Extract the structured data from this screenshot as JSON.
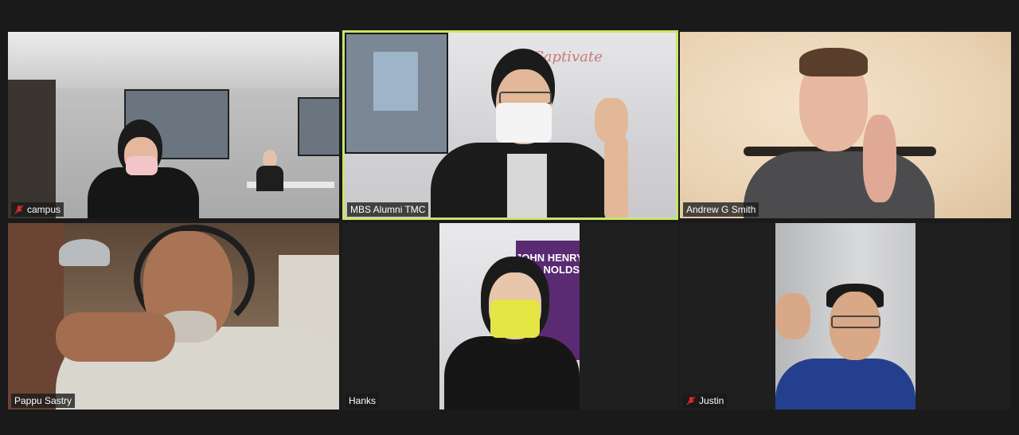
{
  "colors": {
    "background": "#1a1a1a",
    "active_speaker_border": "#c8e66b",
    "muted_icon": "#e02828",
    "nameplate_text": "#ffffff"
  },
  "participants": [
    {
      "name": "campus",
      "muted": true,
      "icon": "mic-muted-icon"
    },
    {
      "name": "MBS Alumni TMC",
      "muted": false,
      "active_speaker": true
    },
    {
      "name": "Andrew G Smith",
      "muted": false
    },
    {
      "name": "Pappu Sastry",
      "muted": false
    },
    {
      "name": "Hanks",
      "muted": false
    },
    {
      "name": "Justin",
      "muted": true,
      "icon": "mic-muted-icon"
    }
  ],
  "whiteboard_text": "Captivate",
  "backdrop_text": "JOHN HENRY\nNOLDS"
}
